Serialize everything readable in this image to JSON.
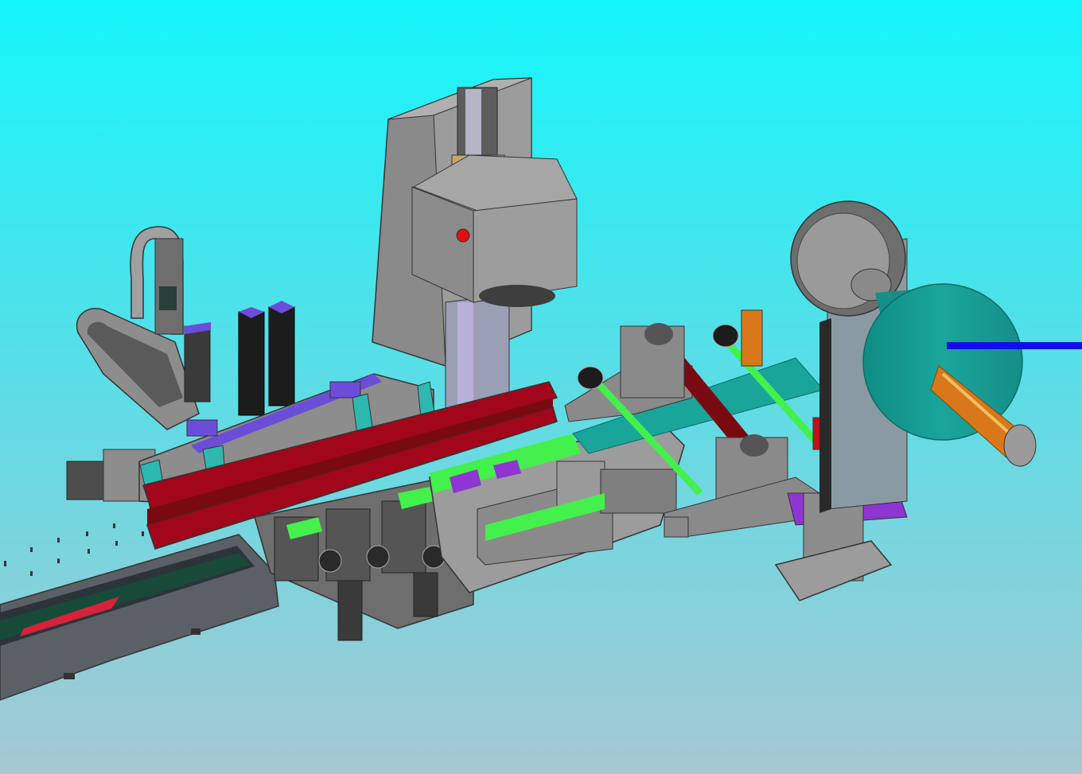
{
  "scene": {
    "subject": "cad-assembly-render",
    "colors": {
      "background_top": "#14f6fb",
      "background_bottom": "#a6c8d2",
      "frame_gray": "#8a8a8a",
      "frame_dark": "#5f5f5f",
      "rail_red": "#a2061a",
      "roller_dark_red": "#7a0a12",
      "shaft_green": "#44f04c",
      "tape_teal": "#1aa59b",
      "bracket_orange": "#d9781a",
      "base_purple": "#8e35d2",
      "block_violet": "#6c4dd9",
      "wire_blue": "#1010e6",
      "shaft_orange": "#f0a020",
      "marker_red": "#e01010"
    },
    "icons": [
      "tape-reel-icon",
      "lift-column-icon",
      "gantry-arm-icon",
      "conveyor-tray-icon",
      "red-rail-icon",
      "roller-shaft-icon"
    ]
  }
}
